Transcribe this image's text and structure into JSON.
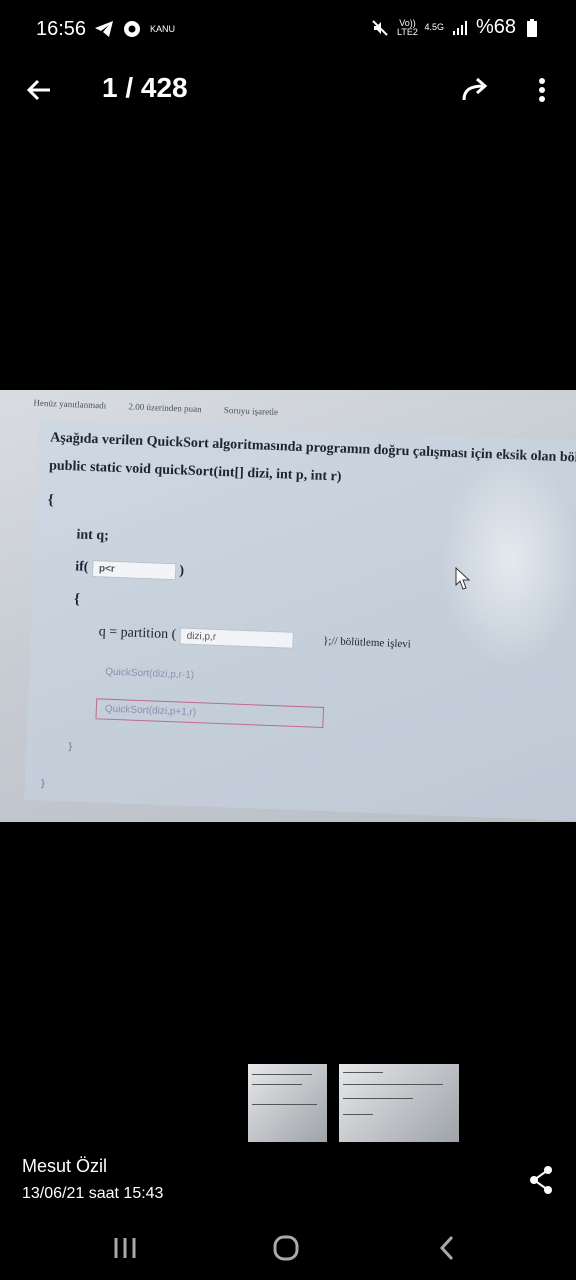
{
  "status": {
    "time": "16:56",
    "kanu_label": "KANU",
    "volte_label": "Vo)) LTE2",
    "network": "4.5G",
    "battery": "%68"
  },
  "viewer": {
    "counter": "1 / 428"
  },
  "photo": {
    "meta_status": "Henüz yanıtlanmadı",
    "meta_points": "2.00 üzerinden puan",
    "meta_flag": "Soruyu işaretle",
    "question": "Aşağıda verilen QuickSort algoritmasında programın doğru çalışması için eksik olan bölümleri ta",
    "signature": "public static void quickSort(int[] dizi, int p, int r)",
    "open_brace": "{",
    "decl": "int q;",
    "if_kw": "if(",
    "if_value": "p<r",
    "if_close": ")",
    "inner_open": "{",
    "assign": "q = partition (",
    "partition_value": "dizi,p,r",
    "comment": "};// bölütleme işlevi",
    "call1": "QuickSort(dizi,p,r-1)",
    "call2": "QuickSort(dizi,p+1,r)",
    "inner_close": "}",
    "outer_close": "}"
  },
  "footer": {
    "author": "Mesut Özil",
    "date": "13/06/21 saat 15:43"
  },
  "icons": {
    "back": "arrow-left",
    "share": "share-arrow",
    "more": "vertical-dots",
    "share_nodes": "share-nodes"
  }
}
